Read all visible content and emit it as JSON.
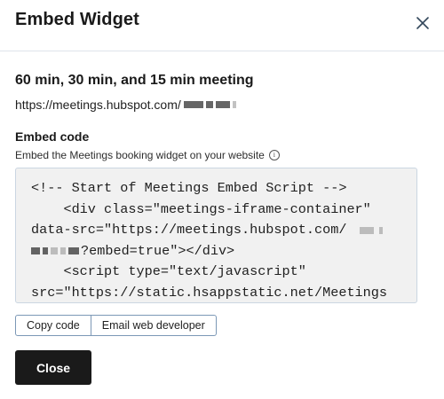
{
  "modal": {
    "title": "Embed Widget",
    "close_icon": "close-icon"
  },
  "meeting": {
    "name": "60 min, 30 min, and 15 min meeting",
    "url_prefix": "https://meetings.hubspot.com/"
  },
  "embed": {
    "label": "Embed code",
    "help_text": "Embed the Meetings booking widget on your website",
    "info_icon": "info-icon",
    "code_lines": [
      "<!-- Start of Meetings Embed Script -->",
      "    <div class=\"meetings-iframe-container\"",
      "data-src=\"https://meetings.hubspot.com/",
      "?embed=true\"></div>",
      "    <script type=\"text/javascript\"",
      "src=\"https://static.hsappstatic.net/Meetings"
    ]
  },
  "actions": {
    "copy_code": "Copy code",
    "email_developer": "Email web developer",
    "close": "Close"
  },
  "colors": {
    "primary_button": "#1a1a1a",
    "code_background": "#f1f1f1",
    "button_border": "#7c98b6"
  }
}
